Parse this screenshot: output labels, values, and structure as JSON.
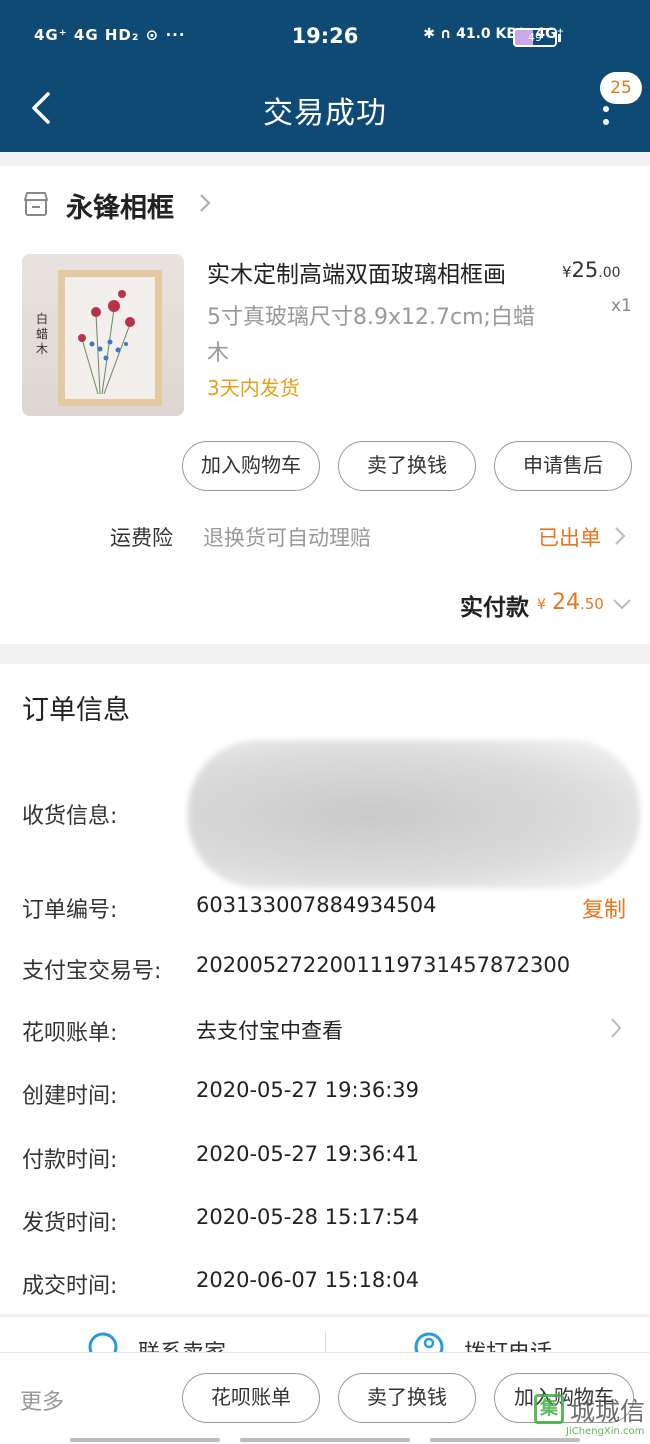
{
  "status_bar": {
    "signals": "4G⁺ 4G HD₂ ⊙ ···",
    "time": "19:26",
    "right": "✱ ∩ 41.0 KB/s 4G⁺",
    "battery": "49"
  },
  "header": {
    "title": "交易成功",
    "badge": "25"
  },
  "shop": {
    "name": "永锋相框"
  },
  "product": {
    "thumb_caption": "白蜡木",
    "title": "实木定制高端双面玻璃相框画",
    "price_currency": "¥",
    "price_int": "25",
    "price_dec": ".00",
    "qty": "x1",
    "spec": "5寸真玻璃尺寸8.9x12.7cm;白蜡木",
    "ship": "3天内发货"
  },
  "item_actions": {
    "add_cart": "加入购物车",
    "resell": "卖了换钱",
    "after_sale": "申请售后"
  },
  "insurance": {
    "label": "运费险",
    "desc": "退换货可自动理赔",
    "status": "已出单"
  },
  "payment": {
    "label": "实付款",
    "currency": "¥",
    "amount_int": "24",
    "amount_dec": ".50"
  },
  "order_info": {
    "title": "订单信息",
    "address_label": "收货信息:",
    "order_no_label": "订单编号:",
    "order_no": "603133007884934504",
    "copy": "复制",
    "alipay_label": "支付宝交易号:",
    "alipay_no": "2020052722001119731457872300",
    "huabei_label": "花呗账单:",
    "huabei_value": "去支付宝中查看",
    "created_label": "创建时间:",
    "created": "2020-05-27 19:36:39",
    "paid_label": "付款时间:",
    "paid": "2020-05-27 19:36:41",
    "shipped_label": "发货时间:",
    "shipped": "2020-05-28 15:17:54",
    "closed_label": "成交时间:",
    "closed": "2020-06-07 15:18:04"
  },
  "contact": {
    "seller": "联系卖家",
    "call": "拨打电话"
  },
  "bottom_bar": {
    "more": "更多",
    "huabei": "花呗账单",
    "resell": "卖了换钱",
    "add_cart": "加入购物车"
  },
  "watermark": {
    "mark": "集",
    "cn": "城城信",
    "en": "JiChengXin.com"
  }
}
